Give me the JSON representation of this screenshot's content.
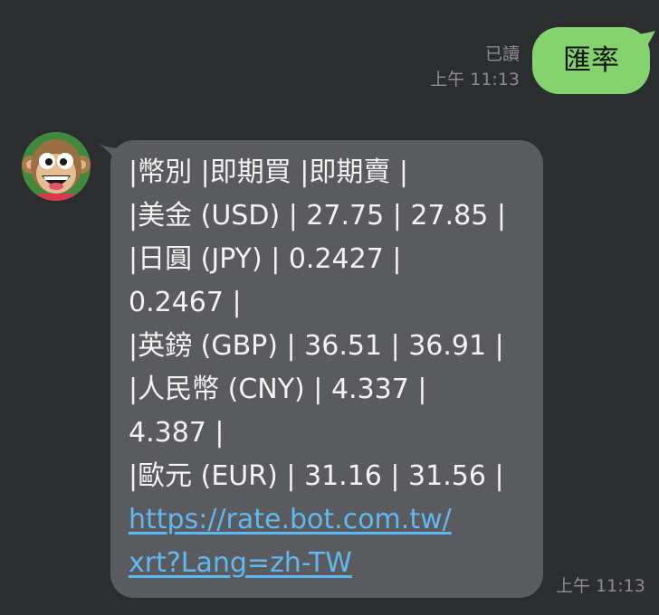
{
  "outgoing": {
    "read_status": "已讀",
    "time": "上午 11:13",
    "text": "匯率"
  },
  "incoming": {
    "time": "上午 11:13",
    "lines": [
      "|幣別  |即期買 |即期賣 |",
      "|美金 (USD) | 27.75 | 27.85 |",
      "|日圓 (JPY) | 0.2427 |",
      "0.2467 |",
      "|英鎊 (GBP) | 36.51 | 36.91 |",
      "|人民幣 (CNY) | 4.337 |",
      "4.387 |",
      "|歐元 (EUR) | 31.16 | 31.56 |"
    ],
    "link_lines": [
      "https://rate.bot.com.tw/",
      "xrt?Lang=zh-TW"
    ]
  },
  "colors": {
    "background": "#2c2d2f",
    "outgoing_bubble": "#85d36f",
    "incoming_bubble": "#5a5b5e",
    "link": "#5fb8ef",
    "meta_text": "#8c8d90"
  },
  "icons": {
    "avatar": "monkey-avatar-icon"
  }
}
